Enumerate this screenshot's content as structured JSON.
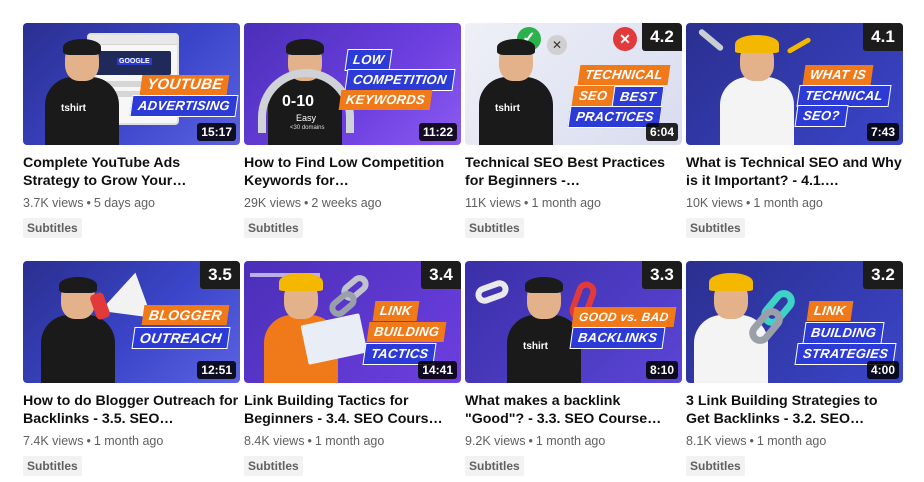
{
  "videos": [
    {
      "title": "Complete YouTube Ads Strategy to Grow Your…",
      "views": "3.7K views",
      "age": "5 days ago",
      "badge": "Subtitles",
      "duration": "15:17",
      "chapter": "",
      "thumb_text": [
        "YOUTUBE",
        "ADVERTISING"
      ],
      "shirt_text": "tshirt",
      "screen_text": "GOOGLE"
    },
    {
      "title": "How to Find Low Competition Keywords for…",
      "views": "29K views",
      "age": "2 weeks ago",
      "badge": "Subtitles",
      "duration": "11:22",
      "chapter": "",
      "thumb_text": [
        "LOW",
        "COMPETITION",
        "KEYWORDS"
      ],
      "gauge_value": "0-10",
      "gauge_label": "Easy",
      "gauge_sub": "<30 domains"
    },
    {
      "title": "Technical SEO Best Practices for Beginners -…",
      "views": "11K views",
      "age": "1 month ago",
      "badge": "Subtitles",
      "duration": "6:04",
      "chapter": "4.2",
      "thumb_text": [
        "TECHNICAL",
        "SEO",
        "BEST",
        "PRACTICES"
      ],
      "shirt_text": "tshirt"
    },
    {
      "title": "What is Technical SEO and Why is it Important? - 4.1.…",
      "views": "10K views",
      "age": "1 month ago",
      "badge": "Subtitles",
      "duration": "7:43",
      "chapter": "4.1",
      "thumb_text": [
        "WHAT IS",
        "TECHNICAL",
        "SEO?"
      ]
    },
    {
      "title": "How to do Blogger Outreach for Backlinks - 3.5. SEO…",
      "views": "7.4K views",
      "age": "1 month ago",
      "badge": "Subtitles",
      "duration": "12:51",
      "chapter": "3.5",
      "thumb_text": [
        "BLOGGER",
        "OUTREACH"
      ]
    },
    {
      "title": "Link Building Tactics for Beginners - 3.4. SEO Cours…",
      "views": "8.4K views",
      "age": "1 month ago",
      "badge": "Subtitles",
      "duration": "14:41",
      "chapter": "3.4",
      "thumb_text": [
        "LINK",
        "BUILDING",
        "TACTICS"
      ]
    },
    {
      "title": "What makes a backlink \"Good\"? - 3.3. SEO Course…",
      "views": "9.2K views",
      "age": "1 month ago",
      "badge": "Subtitles",
      "duration": "8:10",
      "chapter": "3.3",
      "thumb_text": [
        "GOOD vs. BAD",
        "BACKLINKS"
      ],
      "shirt_text": "tshirt"
    },
    {
      "title": "3 Link Building Strategies to Get Backlinks - 3.2. SEO…",
      "views": "8.1K views",
      "age": "1 month ago",
      "badge": "Subtitles",
      "duration": "4:00",
      "chapter": "3.2",
      "thumb_text": [
        "LINK",
        "BUILDING",
        "STRATEGIES"
      ]
    }
  ],
  "colors": {
    "thumb_bg": "#3b45c9",
    "tag_orange": "#f07a1a",
    "tag_blue": "#2d3bd6",
    "meta_text": "#606060"
  },
  "icons": [
    "check-icon",
    "x-icon",
    "megaphone-icon",
    "chain-link-icon",
    "hardhat-icon"
  ]
}
